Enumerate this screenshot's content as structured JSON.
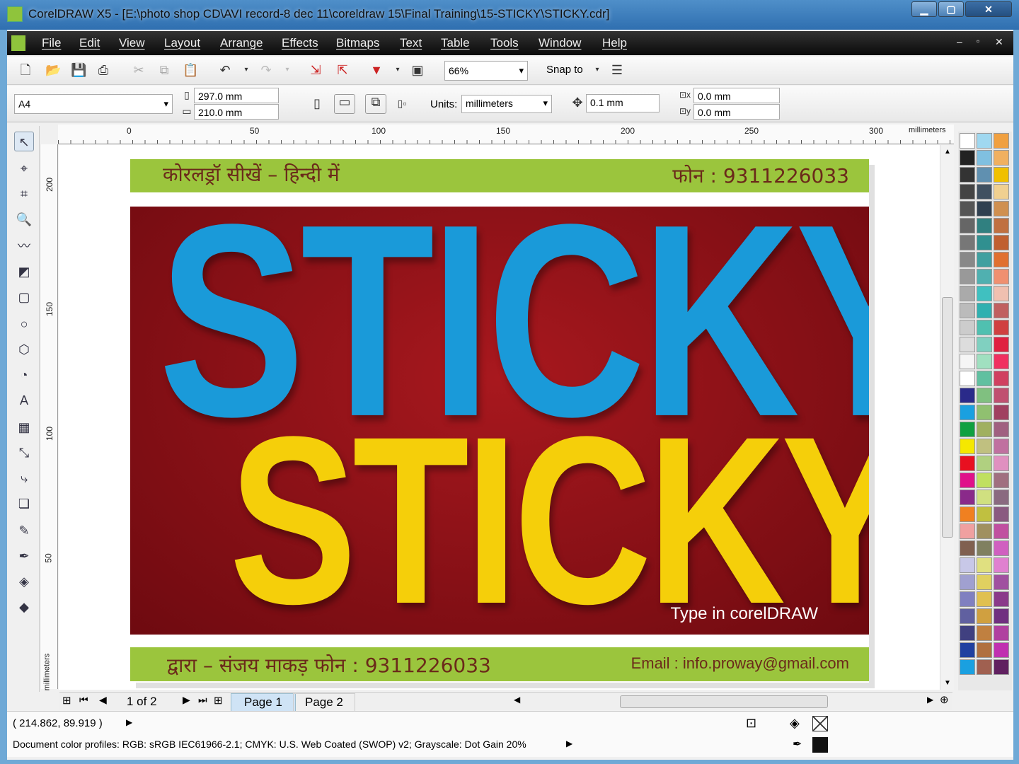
{
  "window": {
    "title": "CorelDRAW X5 - [E:\\photo shop CD\\AVI record-8 dec 11\\coreldraw 15\\Final Training\\15-STICKY\\STICKY.cdr]",
    "min": "▁",
    "max": "▢",
    "close": "✕"
  },
  "menu": [
    "File",
    "Edit",
    "View",
    "Layout",
    "Arrange",
    "Effects",
    "Bitmaps",
    "Text",
    "Table",
    "Tools",
    "Window",
    "Help"
  ],
  "toolbar": {
    "zoom": "66%",
    "snap_to": "Snap to"
  },
  "property_bar": {
    "paper": "A4",
    "width": "297.0 mm",
    "height": "210.0 mm",
    "units_label": "Units:",
    "units": "millimeters",
    "nudge": "0.1 mm",
    "dup_x": "0.0 mm",
    "dup_y": "0.0 mm"
  },
  "ruler": {
    "top": [
      "0",
      "50",
      "100",
      "150",
      "200",
      "250",
      "300"
    ],
    "unit": "millimeters",
    "left": [
      "200",
      "150",
      "100",
      "50"
    ],
    "left_unit": "millimeters"
  },
  "poster": {
    "header_left": "कोरलड्रॉ सीखें – हिन्दी में",
    "header_right": "फोन : 9311226033",
    "line1": "STICKY",
    "line2": "STICKY",
    "caption": "Type in corelDRAW",
    "footer_left": "द्वारा – संजय माकड़ फोन : 9311226033",
    "footer_right": "Email : info.proway@gmail.com",
    "colors": {
      "green": "#9bc53d",
      "red": "#8a1016",
      "blue": "#1a9ad9",
      "yellow": "#f5cf0a"
    }
  },
  "pagebar": {
    "count": "1 of 2",
    "tabs": [
      "Page 1",
      "Page 2"
    ]
  },
  "status": {
    "coords": "( 214.862, 89.919 )",
    "profiles": "Document color profiles: RGB: sRGB IEC61966-2.1; CMYK: U.S. Web Coated (SWOP) v2; Grayscale: Dot Gain 20%"
  },
  "palette": {
    "col1": [
      "#ffffff",
      "#222222",
      "#333333",
      "#444444",
      "#555555",
      "#666666",
      "#777777",
      "#888888",
      "#999999",
      "#aaaaaa",
      "#bbbbbb",
      "#cccccc",
      "#dddddd",
      "#f5f5f5",
      "#ffffff",
      "#2a2a8a",
      "#1aa0e0",
      "#10a040",
      "#f5e800",
      "#e81020",
      "#e0108a",
      "#8a2a8a",
      "#f08020",
      "#f0a0a0",
      "#806050",
      "#c8c8e8",
      "#a0a0d0",
      "#8080c0",
      "#6060a0",
      "#404080",
      "#2040a0",
      "#1aa0e0"
    ],
    "col2": [
      "#a0d8f0",
      "#80c0e0",
      "#6090b0",
      "#405060",
      "#304050",
      "#308080",
      "#309090",
      "#40a0a0",
      "#50b0b0",
      "#40c0c0",
      "#30b0b0",
      "#50c0b0",
      "#80d0c0",
      "#a0e0c0",
      "#60c0a0",
      "#80c080",
      "#90c070",
      "#a0b060",
      "#c0c080",
      "#b0d080",
      "#c0e060",
      "#d0e080",
      "#c0c040",
      "#a09060",
      "#808060",
      "#e0e080",
      "#e0d060",
      "#e0c050",
      "#d0a040",
      "#c08040",
      "#b07040",
      "#a06050"
    ],
    "col3": [
      "#f0a040",
      "#f0b060",
      "#f0c000",
      "#f0d090",
      "#d09050",
      "#c07040",
      "#c06030",
      "#e07030",
      "#f09070",
      "#f0c0b0",
      "#c06060",
      "#d04040",
      "#e02040",
      "#f03060",
      "#d04060",
      "#c05070",
      "#a04060",
      "#a06080",
      "#c070a0",
      "#e090c0",
      "#a07080",
      "#8a6a80",
      "#8a5a80",
      "#c050a0",
      "#d060c0",
      "#e080d0",
      "#a050a0",
      "#8a3a8a",
      "#703080",
      "#b040a0",
      "#c030b0",
      "#602060"
    ]
  }
}
